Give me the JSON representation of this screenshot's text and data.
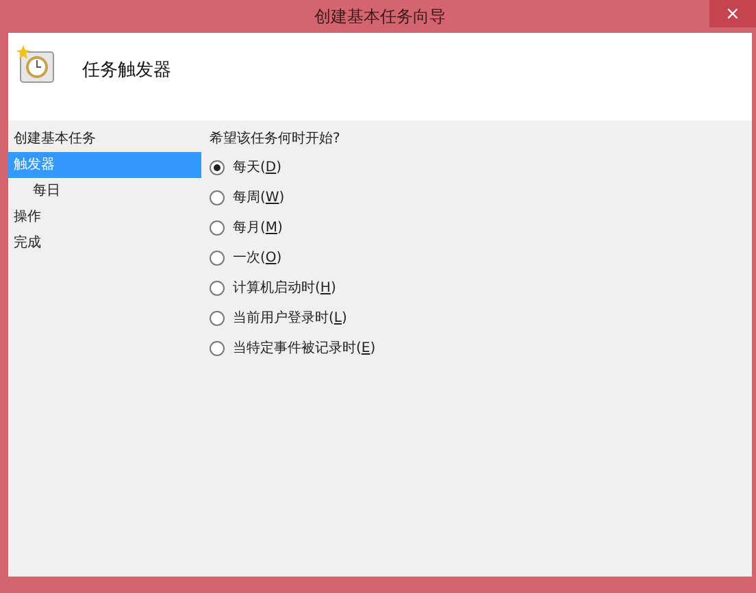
{
  "window": {
    "title": "创建基本任务向导",
    "close": "×"
  },
  "header": {
    "title": "任务触发器"
  },
  "sidebar": {
    "items": [
      {
        "label": "创建基本任务",
        "selected": false
      },
      {
        "label": "触发器",
        "selected": true,
        "children": [
          {
            "label": "每日",
            "selected": false
          }
        ]
      },
      {
        "label": "操作",
        "selected": false
      },
      {
        "label": "完成",
        "selected": false
      }
    ]
  },
  "question": "希望该任务何时开始?",
  "options": [
    {
      "label": "每天(D)",
      "selected": true
    },
    {
      "label": "每周(W)",
      "selected": false
    },
    {
      "label": "每月(M)",
      "selected": false
    },
    {
      "label": "一次(O)",
      "selected": false
    },
    {
      "label": "计算机启动时(H)",
      "selected": false
    },
    {
      "label": "当前用户登录时(L)",
      "selected": false
    },
    {
      "label": "当特定事件被记录时(E)",
      "selected": false
    }
  ]
}
